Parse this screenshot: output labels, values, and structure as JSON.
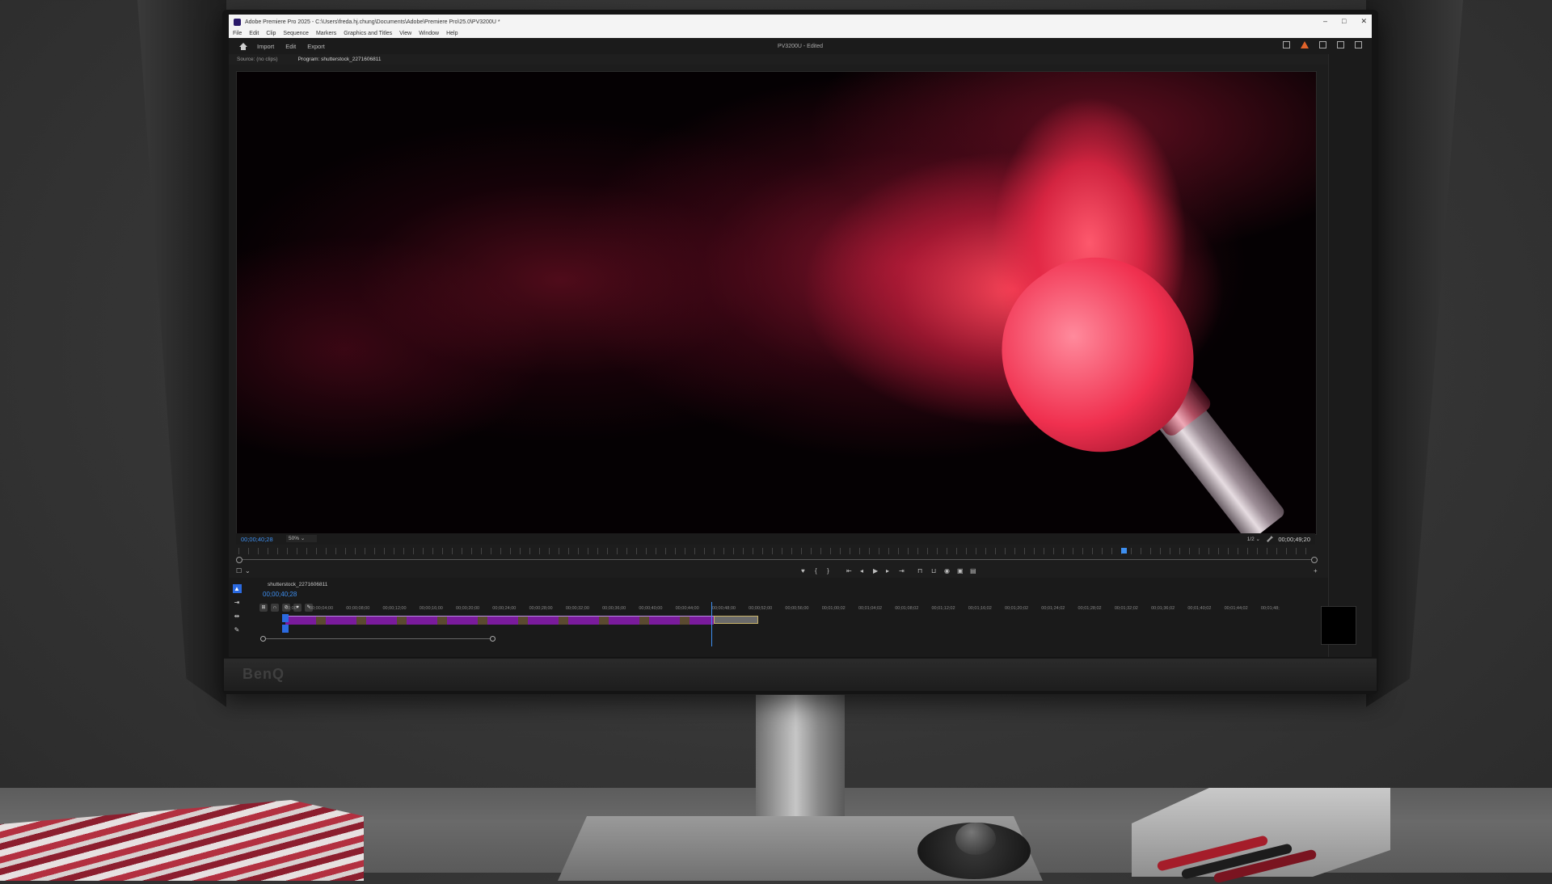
{
  "window": {
    "title": "Adobe Premiere Pro 2025 - C:\\Users\\freda.hj.chung\\Documents\\Adobe\\Premiere Pro\\25.0\\PV3200U *",
    "controls": [
      "–",
      "□",
      "✕"
    ]
  },
  "menu": [
    "File",
    "Edit",
    "Clip",
    "Sequence",
    "Markers",
    "Graphics and Titles",
    "View",
    "Window",
    "Help"
  ],
  "header": {
    "links": [
      "Import",
      "Edit",
      "Export"
    ],
    "project_title": "PV3200U - Edited"
  },
  "panels": {
    "source_tab": "Source: (no clips)",
    "program_tab": "Program: shutterstock_2271606811"
  },
  "program_monitor": {
    "current_timecode": "00;00;40;28",
    "zoom": "50%",
    "resolution": "1/2",
    "duration": "00;00;49;20",
    "playhead_fraction": 0.82
  },
  "timeline": {
    "sequence_name": "shutterstock_2271606811",
    "timecode": "00;00;40;28",
    "ruler_labels": [
      "00;00",
      "00;00;04;00",
      "00;00;08;00",
      "00;00;12;00",
      "00;00;16;00",
      "00;00;20;00",
      "00;00;24;00",
      "00;00;28;00",
      "00;00;32;00",
      "00;00;36;00",
      "00;00;40;00",
      "00;00;44;00",
      "00;00;48;00",
      "00;00;52;00",
      "00;00;56;00",
      "00;01;00;02",
      "00;01;04;02",
      "00;01;08;02",
      "00;01;12;02",
      "00;01;16;02",
      "00;01;20;02",
      "00;01;24;02",
      "00;01;28;02",
      "00;01;32;02",
      "00;01;36;02",
      "00;01;40;02",
      "00;01;44;02",
      "00;01;48;"
    ]
  },
  "monitor_brand": "BenQ",
  "colors": {
    "accent_blue": "#3e8ff0",
    "clip_purple": "#7a1b9c",
    "warning_orange": "#e0632a"
  },
  "icons": {
    "home": "home-icon",
    "warning": "warning-icon",
    "wrench": "wrench-icon",
    "selection_tool": "selection-tool-icon"
  }
}
